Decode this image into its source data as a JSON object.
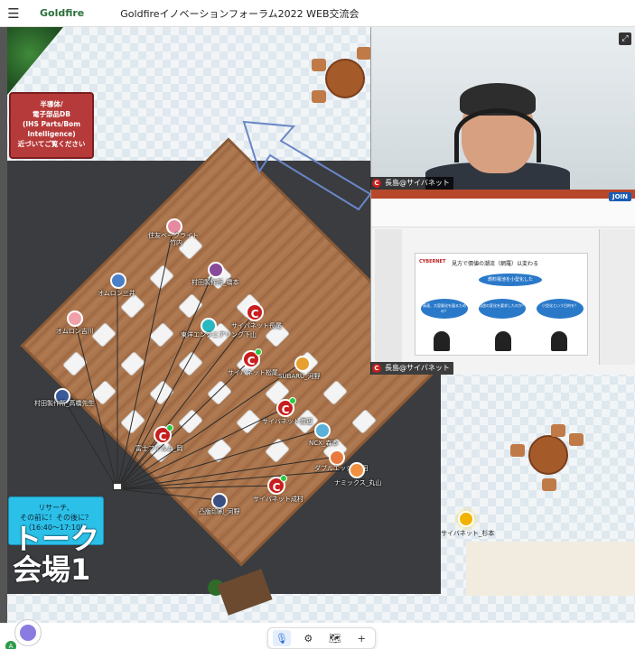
{
  "header": {
    "menu_icon": "hamburger-icon",
    "brand": "Goldfire",
    "title": "Goldfireイノベーションフォーラム2022 WEB交流会"
  },
  "map": {
    "sign_text_lines": [
      "半導体/",
      "電子部品DB",
      "(IHS Parts/Bom",
      "Intelligence)",
      "近づいてご覧ください"
    ],
    "talk_area_label_line1": "トーク",
    "talk_area_label_line2": "会場1",
    "info_box_lines": [
      "リサーチ、",
      "その前に！その後に？",
      "（16:40～17:10）"
    ],
    "participants": [
      {
        "name": "住友ベークライト",
        "sub": "竹内"
      },
      {
        "name": "村田製作所_橋本"
      },
      {
        "name": "オムロン三井"
      },
      {
        "name": "サイバネット長尾"
      },
      {
        "name": "東洋エンジニアリング下山"
      },
      {
        "name": "オムロン吉川"
      },
      {
        "name": "サイバネット松尾"
      },
      {
        "name": "SUBARU_河野"
      },
      {
        "name": "村田製作所_高橋先生"
      },
      {
        "name": "サイバネット渡辺"
      },
      {
        "name": "富士フイルム_岡"
      },
      {
        "name": "NCX_森本"
      },
      {
        "name": "ダブルエッジ_早田"
      },
      {
        "name": "ナミックス_丸山"
      },
      {
        "name": "サイバネット成村"
      },
      {
        "name": "凸版印刷_河野"
      },
      {
        "name": "サイバネット_杉本"
      }
    ]
  },
  "videos": [
    {
      "label": "長島@サイバネット",
      "expand_icon": "expand-icon"
    },
    {
      "label": "長島@サイバネット",
      "join_label": "JOIN"
    }
  ],
  "slide": {
    "logo": "CYBERNET",
    "title": "見方で價値の潮流（網羅）以変わる",
    "cloud_main": "燃料電池を小型化した",
    "clouds": [
      "高速、大容量化を図るための？",
      "用途の変化を要求したのか？",
      "小型化という目的を？"
    ]
  },
  "toolbar": {
    "items": [
      {
        "icon": "microphone-icon",
        "label": "🎙"
      },
      {
        "icon": "settings-gear-icon",
        "label": "⚙"
      },
      {
        "icon": "map-icon",
        "label": "🗺"
      },
      {
        "icon": "plus-icon",
        "label": "+"
      }
    ]
  },
  "assistant": {
    "badge": "A"
  }
}
